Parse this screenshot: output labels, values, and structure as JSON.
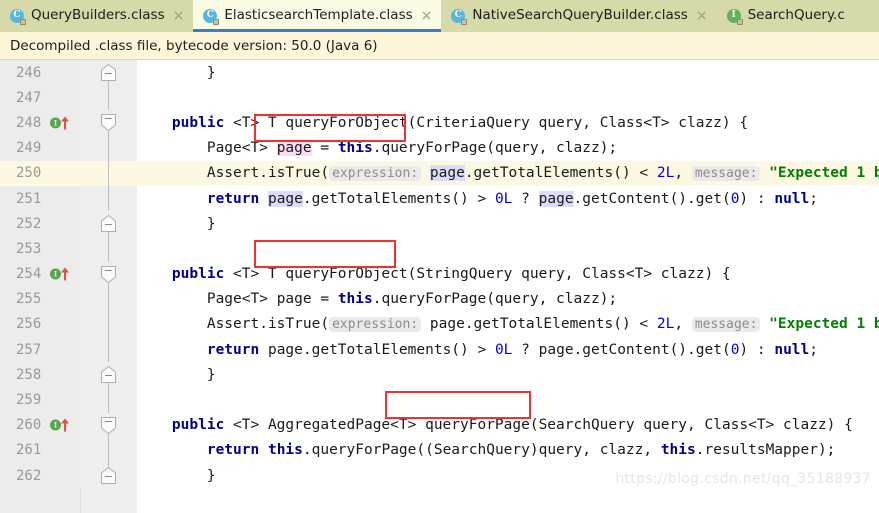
{
  "window": {
    "tabs": [
      {
        "label": "QueryBuilders.class",
        "icon": "java-class-icon",
        "kind": "class",
        "active": false,
        "closable": true
      },
      {
        "label": "ElasticsearchTemplate.class",
        "icon": "java-class-icon",
        "kind": "class",
        "active": true,
        "closable": true
      },
      {
        "label": "NativeSearchQueryBuilder.class",
        "icon": "java-class-icon",
        "kind": "class",
        "active": false,
        "closable": true
      },
      {
        "label": "SearchQuery.c",
        "icon": "java-interface-icon",
        "kind": "interface",
        "active": false,
        "closable": false
      }
    ],
    "close_glyph": "×"
  },
  "notification": {
    "text": "Decompiled .class file, bytecode version: 50.0 (Java 6)"
  },
  "editor": {
    "current_line": 250,
    "lines": [
      {
        "num": "246",
        "marker": false,
        "fold": "close",
        "rail": "none"
      },
      {
        "num": "247",
        "marker": false,
        "fold": "none",
        "rail": "none"
      },
      {
        "num": "248",
        "marker": true,
        "fold": "open",
        "rail": "none"
      },
      {
        "num": "249",
        "marker": false,
        "fold": "none",
        "rail": "inner"
      },
      {
        "num": "250",
        "marker": false,
        "fold": "none",
        "rail": "inner"
      },
      {
        "num": "251",
        "marker": false,
        "fold": "none",
        "rail": "inner"
      },
      {
        "num": "252",
        "marker": false,
        "fold": "close",
        "rail": "none"
      },
      {
        "num": "253",
        "marker": false,
        "fold": "none",
        "rail": "none"
      },
      {
        "num": "254",
        "marker": true,
        "fold": "open",
        "rail": "none"
      },
      {
        "num": "255",
        "marker": false,
        "fold": "none",
        "rail": "inner"
      },
      {
        "num": "256",
        "marker": false,
        "fold": "none",
        "rail": "inner"
      },
      {
        "num": "257",
        "marker": false,
        "fold": "none",
        "rail": "inner"
      },
      {
        "num": "258",
        "marker": false,
        "fold": "close",
        "rail": "none"
      },
      {
        "num": "259",
        "marker": false,
        "fold": "none",
        "rail": "none"
      },
      {
        "num": "260",
        "marker": true,
        "fold": "open",
        "rail": "none"
      },
      {
        "num": "261",
        "marker": false,
        "fold": "none",
        "rail": "inner"
      },
      {
        "num": "262",
        "marker": false,
        "fold": "close",
        "rail": "none"
      }
    ],
    "code": {
      "l246": "        }",
      "l247": "",
      "l248_a": "    public ",
      "l248_b": "<T> T queryForObject(",
      "l248_c": "CriteriaQuery query,",
      "l248_d": " Class<T> clazz) {",
      "l249_a": "        Page<T> ",
      "l249_b": "page",
      "l249_c": " = ",
      "l249_d": "this",
      "l249_e": ".queryForPage(query, clazz);",
      "l250_a": "        Assert.isTrue(",
      "l250_hint1": "expression:",
      "l250_b": "page",
      "l250_c": ".getTotalElements() < ",
      "l250_d": "2L",
      "l250_e": ",",
      "l250_hint2": "message:",
      "l250_f": "\"Expected 1 b",
      "l251_a": "        ",
      "l251_kw": "return",
      "l251_b": " ",
      "l251_c": "page",
      "l251_d": ".getTotalElements() > ",
      "l251_e": "0L",
      "l251_f": " ? ",
      "l251_g": "page",
      "l251_h": ".getContent().get(",
      "l251_i": "0",
      "l251_j": ") : ",
      "l251_k": "null",
      "l251_l": ";",
      "l252": "        }",
      "l253": "",
      "l254_a": "    public ",
      "l254_b": "<T> T queryForObject(",
      "l254_c": "StringQuery query,",
      "l254_d": " Class<T> clazz) {",
      "l255_a": "        Page<T> ",
      "l255_b": "page",
      "l255_c": " = ",
      "l255_d": "this",
      "l255_e": ".queryForPage(query, clazz);",
      "l256_a": "        Assert.isTrue(",
      "l256_hint1": "expression:",
      "l256_b": "page",
      "l256_c": ".getTotalElements() < ",
      "l256_d": "2L",
      "l256_e": ",",
      "l256_hint2": "message:",
      "l256_f": "\"Expected 1 b",
      "l257_a": "        ",
      "l257_kw": "return",
      "l257_b": " ",
      "l257_c": "page",
      "l257_d": ".getTotalElements() > ",
      "l257_e": "0L",
      "l257_f": " ? ",
      "l257_g": "page",
      "l257_h": ".getContent().get(",
      "l257_i": "0",
      "l257_j": ") : ",
      "l257_k": "null",
      "l257_l": ";",
      "l258": "        }",
      "l259": "",
      "l260_a": "    public ",
      "l260_b": "<T> AggregatedPage<T> queryForPage(",
      "l260_c": "SearchQuery query,",
      "l260_d": " Class<T> clazz) {",
      "l261_a": "        ",
      "l261_kw": "return",
      "l261_b": " ",
      "l261_kw2": "this",
      "l261_c": ".queryForPage((SearchQuery)query, clazz, ",
      "l261_kw3": "this",
      "l261_d": ".resultsMapper);",
      "l262": "        }"
    }
  },
  "annotations": {
    "boxes": [
      {
        "name": "criteria-query-highlight",
        "target": "CriteriaQuery query,"
      },
      {
        "name": "string-query-highlight",
        "target": "StringQuery query,"
      },
      {
        "name": "search-query-highlight",
        "target": "SearchQuery query,"
      }
    ],
    "box_color": "#f0322e"
  },
  "watermark": {
    "text": "https://blog.csdn.net/qq_35188937"
  }
}
